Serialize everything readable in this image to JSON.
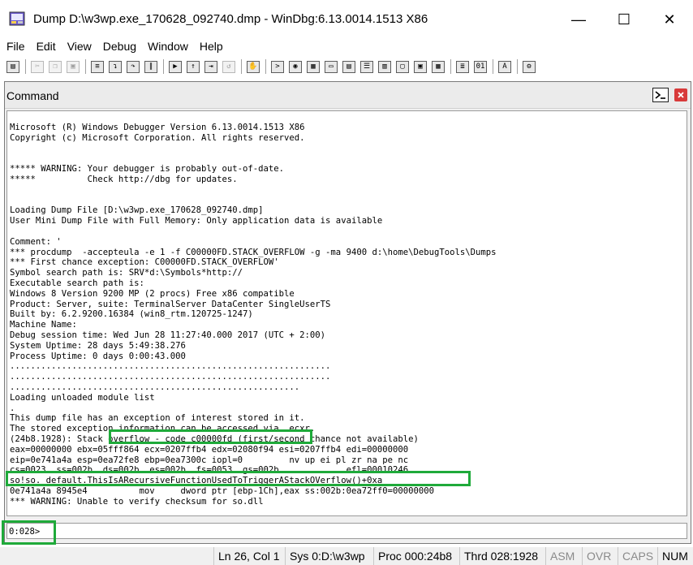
{
  "window": {
    "title": "Dump D:\\w3wp.exe_170628_092740.dmp - WinDbg:6.13.0014.1513 X86",
    "minimize_glyph": "—",
    "maximize_glyph": "☐",
    "close_glyph": "✕"
  },
  "menu": [
    "File",
    "Edit",
    "View",
    "Debug",
    "Window",
    "Help"
  ],
  "toolbar": {
    "groups": [
      [
        "open-icon"
      ],
      [
        "cut-icon",
        "copy-icon",
        "paste-icon"
      ],
      [
        "source-mode-icon",
        "step-into-icon",
        "step-over-icon",
        "break-icon"
      ],
      [
        "go-icon",
        "step-out-icon",
        "run-to-cursor-icon",
        "restart-icon"
      ],
      [
        "stop-icon"
      ],
      [
        "command-window-icon",
        "watch-window-icon",
        "locals-icon",
        "registers-icon",
        "memory-icon",
        "call-stack-icon",
        "disassembly-icon",
        "scratch-pad-icon",
        "processes-icon",
        "modules-icon"
      ],
      [
        "source-lines-icon",
        "hex-mode-icon"
      ],
      [
        "font-icon"
      ],
      [
        "options-icon"
      ]
    ]
  },
  "panel": {
    "title": "Command"
  },
  "output_lines": [
    "Microsoft (R) Windows Debugger Version 6.13.0014.1513 X86",
    "Copyright (c) Microsoft Corporation. All rights reserved.",
    "",
    "",
    "***** WARNING: Your debugger is probably out-of-date.",
    "*****          Check http://dbg for updates.",
    "",
    "",
    "Loading Dump File [D:\\w3wp.exe_170628_092740.dmp]",
    "User Mini Dump File with Full Memory: Only application data is available",
    "",
    "Comment: '",
    "*** procdump  -accepteula -e 1 -f C00000FD.STACK_OVERFLOW -g -ma 9400 d:\\home\\DebugTools\\Dumps",
    "*** First chance exception: C00000FD.STACK_OVERFLOW'",
    "Symbol search path is: SRV*d:\\Symbols*http://",
    "Executable search path is:",
    "Windows 8 Version 9200 MP (2 procs) Free x86 compatible",
    "Product: Server, suite: TerminalServer DataCenter SingleUserTS",
    "Built by: 6.2.9200.16384 (win8_rtm.120725-1247)",
    "Machine Name:",
    "Debug session time: Wed Jun 28 11:27:40.000 2017 (UTC + 2:00)",
    "System Uptime: 28 days 5:49:38.276",
    "Process Uptime: 0 days 0:00:43.000",
    "..............................................................",
    "..............................................................",
    "........................................................",
    "Loading unloaded module list",
    ".",
    "This dump file has an exception of interest stored in it.",
    "The stored exception information can be accessed via .ecxr.",
    "(24b8.1928): Stack overflow - code c00000fd (first/second chance not available)",
    "eax=00000000 ebx=05fff864 ecx=0207ffb4 edx=02080f94 esi=0207ffb4 edi=00000000",
    "eip=0e741a4a esp=0ea72fe8 ebp=0ea7300c iopl=0         nv up ei pl zr na pe nc",
    "cs=0023  ss=002b  ds=002b  es=002b  fs=0053  gs=002b             efl=00010246",
    "so!so._default.ThisIsARecursiveFunctionUsedToTriggerAStackOVerflow()+0xa",
    "0e741a4a 8945e4          mov     dword ptr [ebp-1Ch],eax ss:002b:0ea72ff0=00000000",
    "*** WARNING: Unable to verify checksum for so.dll"
  ],
  "prompt": {
    "label": "0:028>",
    "value": ""
  },
  "status": {
    "position": "Ln 26, Col 1",
    "sys": "Sys 0:D:\\w3wp",
    "proc": "Proc 000:24b8",
    "thread": "Thrd 028:1928",
    "asm": "ASM",
    "ovr": "OVR",
    "caps": "CAPS",
    "num": "NUM"
  },
  "colors": {
    "highlight": "#1faa3a",
    "close_button_red": "#d83a3a"
  }
}
